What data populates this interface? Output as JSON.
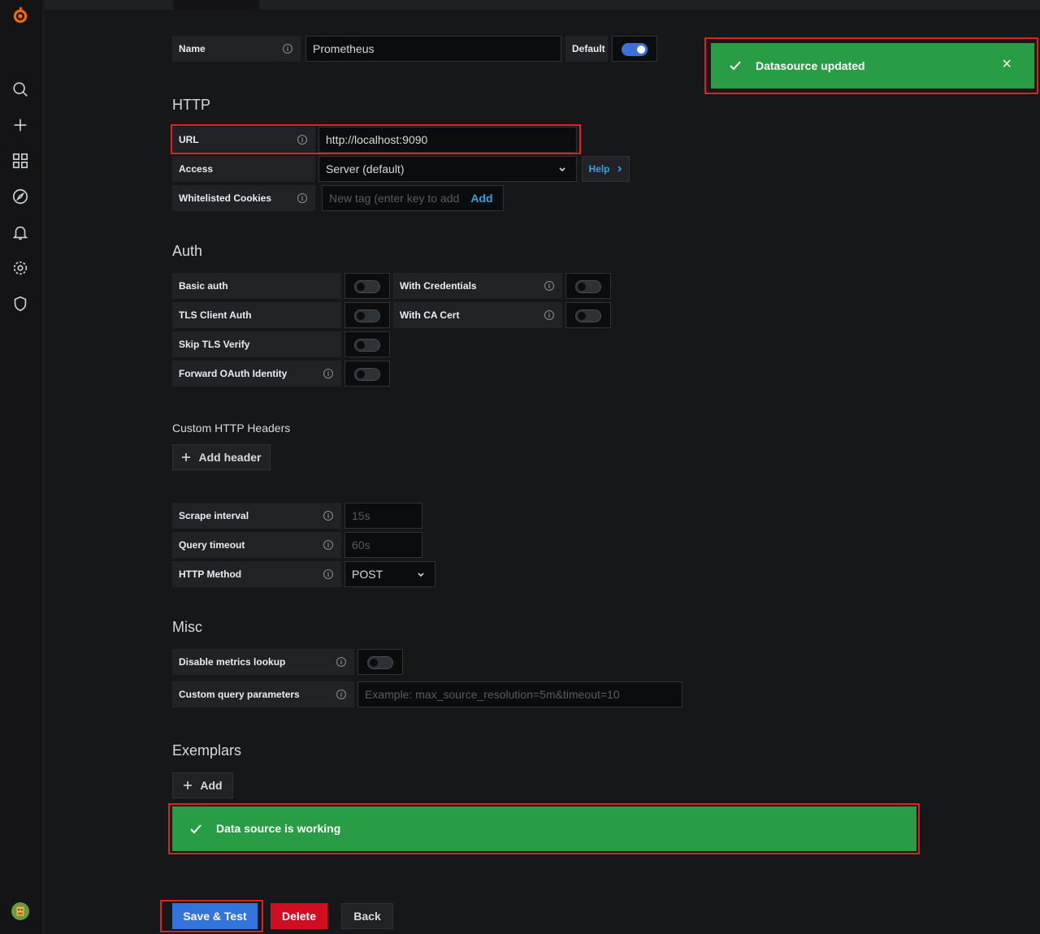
{
  "name_row": {
    "label": "Name",
    "value": "Prometheus",
    "default_label": "Default"
  },
  "toast": {
    "text": "Datasource updated",
    "close": "×"
  },
  "http": {
    "title": "HTTP",
    "url_label": "URL",
    "url_value": "http://localhost:9090",
    "access_label": "Access",
    "access_value": "Server (default)",
    "help_label": "Help",
    "cookies_label": "Whitelisted Cookies",
    "cookies_placeholder": "New tag (enter key to add",
    "cookies_add": "Add"
  },
  "auth": {
    "title": "Auth",
    "basic": "Basic auth",
    "with_credentials": "With Credentials",
    "tls_client": "TLS Client Auth",
    "with_ca": "With CA Cert",
    "skip_tls": "Skip TLS Verify",
    "forward_oauth": "Forward OAuth Identity"
  },
  "headers": {
    "title": "Custom HTTP Headers",
    "add_button": "Add header"
  },
  "prom": {
    "scrape_label": "Scrape interval",
    "scrape_placeholder": "15s",
    "timeout_label": "Query timeout",
    "timeout_placeholder": "60s",
    "method_label": "HTTP Method",
    "method_value": "POST"
  },
  "misc": {
    "title": "Misc",
    "disable_lookup": "Disable metrics lookup",
    "custom_params": "Custom query parameters",
    "custom_params_placeholder": "Example: max_source_resolution=5m&timeout=10"
  },
  "exemplars": {
    "title": "Exemplars",
    "add_button": "Add"
  },
  "alert": {
    "text": "Data source is working"
  },
  "actions": {
    "save": "Save & Test",
    "delete": "Delete",
    "back": "Back"
  },
  "colors": {
    "success": "#299c46",
    "primary": "#3274d9",
    "danger": "#d10e21",
    "highlight": "#e02020"
  }
}
